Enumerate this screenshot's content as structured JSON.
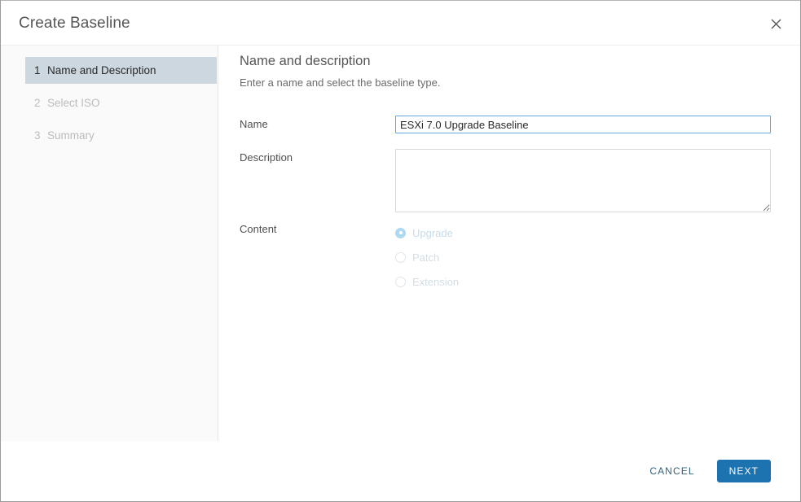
{
  "dialog": {
    "title": "Create Baseline",
    "close_icon": "close-icon"
  },
  "wizard_nav": {
    "steps": [
      {
        "number": "1",
        "label": "Name and Description",
        "state": "active"
      },
      {
        "number": "2",
        "label": "Select ISO",
        "state": "disabled"
      },
      {
        "number": "3",
        "label": "Summary",
        "state": "disabled"
      }
    ]
  },
  "content": {
    "title": "Name and description",
    "subtitle": "Enter a name and select the baseline type.",
    "fields": {
      "name": {
        "label": "Name",
        "value": "ESXi 7.0 Upgrade Baseline",
        "placeholder": ""
      },
      "description": {
        "label": "Description",
        "value": "",
        "placeholder": ""
      },
      "content": {
        "label": "Content",
        "selected": "Upgrade",
        "options": [
          {
            "label": "Upgrade",
            "checked": true,
            "disabled": true
          },
          {
            "label": "Patch",
            "checked": false,
            "disabled": true
          },
          {
            "label": "Extension",
            "checked": false,
            "disabled": true
          }
        ]
      }
    }
  },
  "footer": {
    "cancel_label": "CANCEL",
    "next_label": "NEXT"
  },
  "colors": {
    "primary": "#1d72b0",
    "link": "#31627e",
    "active_nav_bg": "#ccd7e0",
    "focus_border": "#63a6e0",
    "sidebar_bg": "#fafafa"
  }
}
